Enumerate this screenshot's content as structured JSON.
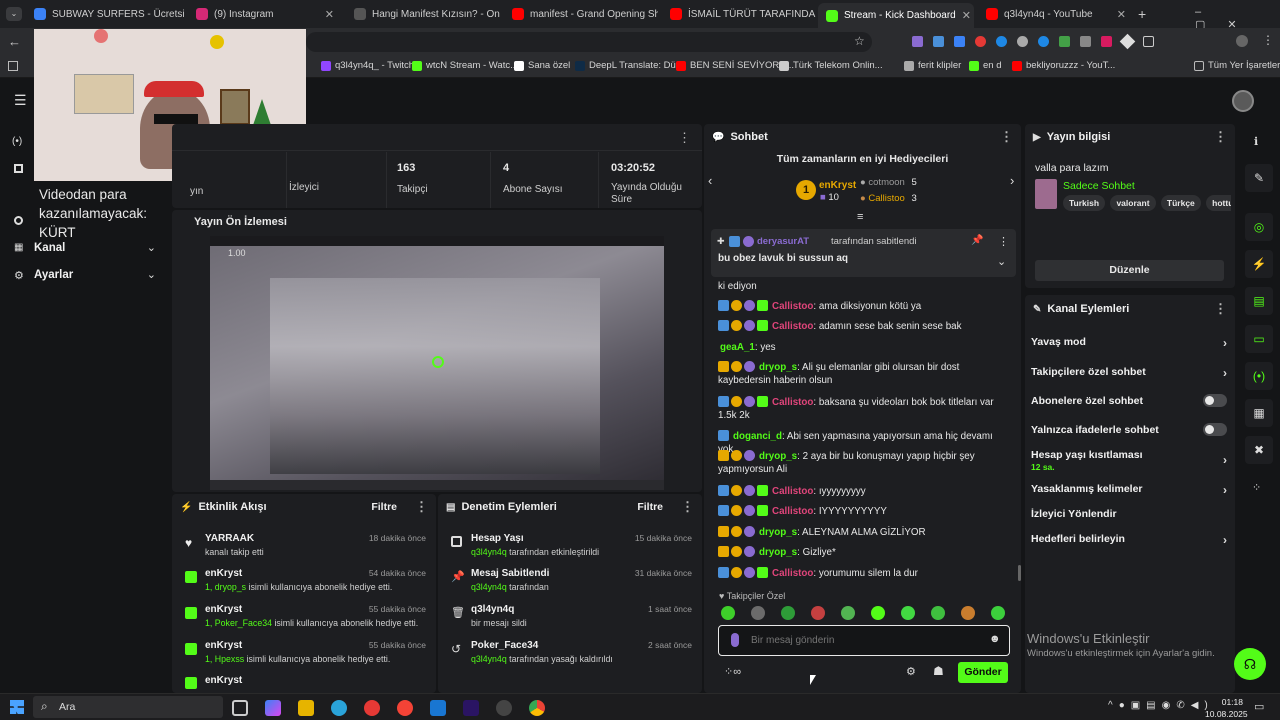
{
  "browser": {
    "tabs": [
      {
        "title": "SUBWAY SURFERS - Ücretsiz Ç",
        "color": "#3b82f6"
      },
      {
        "title": "(9) Instagram",
        "color": "#d62976"
      },
      {
        "title": "Hangi Manifest Kızısın? - Oned",
        "color": "#555555"
      },
      {
        "title": "manifest - Grand Opening Sho",
        "color": "#ff0000"
      },
      {
        "title": "İSMAİL TÜRÜT TARAFINDAN SI",
        "color": "#ff0000"
      },
      {
        "title": "Stream - Kick Dashboard",
        "color": "#53fc18"
      },
      {
        "title": "q3l4yn4q - YouTube",
        "color": "#ff0000"
      }
    ],
    "new_tab": "+",
    "bookmarks": [
      {
        "label": "q3l4yn4q_ - Twitch",
        "color": "#9146ff"
      },
      {
        "label": "wtcN Stream - Watc...",
        "color": "#53fc18"
      },
      {
        "label": "Sana özel",
        "color": "#ffffff"
      },
      {
        "label": "DeepL Translate: Dü...",
        "color": "#0f2b46"
      },
      {
        "label": "BEN SENİ SEVİYORU...",
        "color": "#ff0000"
      },
      {
        "label": "Türk Telekom Onlin...",
        "color": "#cccccc"
      },
      {
        "label": "ferit klipler",
        "color": "#aaaaaa"
      },
      {
        "label": "en d",
        "color": "#53fc18"
      },
      {
        "label": "bekliyoruzzz - YouT...",
        "color": "#ff0000"
      }
    ],
    "all_bookmarks": "Tüm Yer İşaretleri"
  },
  "sidebar": {
    "overlay_caption": "Videodan para kazanılamayacak: KÜRT",
    "items": [
      {
        "label": "Kanal"
      },
      {
        "label": "Ayarlar"
      }
    ]
  },
  "stats": {
    "first_label": "yın",
    "items": [
      {
        "value": "",
        "label": "İzleyici"
      },
      {
        "value": "163",
        "label": "Takipçi"
      },
      {
        "value": "4",
        "label": "Abone Sayısı"
      },
      {
        "value": "03:20:52",
        "label": "Yayında Olduğu Süre"
      }
    ]
  },
  "preview": {
    "title": "Yayın Ön İzlemesi",
    "zoom": "1.00"
  },
  "activity": {
    "title": "Etkinlik Akışı",
    "filter": "Filtre",
    "items": [
      {
        "name": "YARRAAK",
        "desc": "kanalı takip etti",
        "time": "18 dakika önce",
        "icon": "heart-icon"
      },
      {
        "name": "enKryst",
        "highlight": "1, dryop_s",
        "desc": " isimli kullanıcıya abonelik hediye etti.",
        "time": "54 dakika önce",
        "icon": "gift-icon"
      },
      {
        "name": "enKryst",
        "highlight": "1, Poker_Face34",
        "desc": " isimli kullanıcıya abonelik hediye etti.",
        "time": "55 dakika önce",
        "icon": "gift-icon"
      },
      {
        "name": "enKryst",
        "highlight": "1, Hpexss",
        "desc": " isimli kullanıcıya abonelik hediye etti.",
        "time": "55 dakika önce",
        "icon": "gift-icon"
      },
      {
        "name": "enKryst",
        "highlight": "",
        "desc": "",
        "time": "",
        "icon": "gift-icon"
      }
    ]
  },
  "moderation": {
    "title": "Denetim Eylemleri",
    "filter": "Filtre",
    "items": [
      {
        "name": "Hesap Yaşı",
        "user": "q3l4yn4q",
        "desc": " tarafından etkinleştirildi",
        "time": "15 dakika önce",
        "icon": "calendar-icon"
      },
      {
        "name": "Mesaj Sabitlendi",
        "user": "q3l4yn4q",
        "desc": " tarafından",
        "time": "31 dakika önce",
        "icon": "pin-icon"
      },
      {
        "name": "q3l4yn4q",
        "user": "",
        "desc": "bir mesajı sildi",
        "time": "1 saat önce",
        "icon": "trash-icon"
      },
      {
        "name": "Poker_Face34",
        "user": "q3l4yn4q",
        "desc": " tarafından yasağı kaldırıldı",
        "time": "2 saat önce",
        "icon": "undo-icon"
      }
    ]
  },
  "chat": {
    "title": "Sohbet",
    "gifters_title": "Tüm zamanların en iyi Hediyecileri",
    "top_gifter": {
      "name": "enKryst",
      "count": "10",
      "rank": "1"
    },
    "gifters": [
      {
        "name": "cotmoon",
        "count": "5"
      },
      {
        "name": "Callistoo",
        "count": "3"
      }
    ],
    "pinned": {
      "user": "deryasurAT",
      "by": "tarafından sabitlendi",
      "text": "bu obez lavuk bi sussun aq"
    },
    "messages": [
      {
        "user": "",
        "color": "",
        "text": "ki ediyon",
        "badges": ""
      },
      {
        "user": "Callistoo",
        "color": "pink",
        "text": "ama diksiyonun kötü ya",
        "badges": "bgpG"
      },
      {
        "user": "Callistoo",
        "color": "pink",
        "text": "adamın sese bak senin sese bak",
        "badges": "bgpG"
      },
      {
        "user": "geaA_1",
        "color": "green",
        "text": "yes",
        "badges": ""
      },
      {
        "user": "dryop_s",
        "color": "green",
        "text": "Ali şu elemanlar gibi olursan bir dost kaybedersin haberin olsun",
        "badges": "cgp"
      },
      {
        "user": "Callistoo",
        "color": "pink",
        "text": "baksana şu videoları bok bok titleları var 1.5k 2k",
        "badges": "bgpG"
      },
      {
        "user": "doganci_d",
        "color": "green",
        "text": "Abi sen yapmasına yapıyorsun ama hiç devamı yok",
        "badges": "b"
      },
      {
        "user": "dryop_s",
        "color": "green",
        "text": "2 aya bir bu konuşmayı yapıp hiçbir şey yapmıyorsun Ali",
        "badges": "cgp"
      },
      {
        "user": "Callistoo",
        "color": "pink",
        "text": "ıyyyyyyyyy",
        "badges": "bgpG"
      },
      {
        "user": "Callistoo",
        "color": "pink",
        "text": "IYYYYYYYYYY",
        "badges": "bgpG"
      },
      {
        "user": "dryop_s",
        "color": "green",
        "text": "ALEYNAM ALMA GİZLİYOR",
        "badges": "cgp"
      },
      {
        "user": "dryop_s",
        "color": "green",
        "text": "Gizliye*",
        "badges": "cgp"
      },
      {
        "user": "Callistoo",
        "color": "pink",
        "text": "yorumumu silem la dur",
        "badges": "bgpG"
      }
    ],
    "followers_only": "Takipçiler Özel",
    "input_placeholder": "Bir mesaj gönderin",
    "send": "Gönder"
  },
  "stream_info": {
    "title": "Yayın bilgisi",
    "stream_title": "valla para lazım",
    "category": "Sadece Sohbet",
    "tags": [
      "Turkish",
      "valorant",
      "Türkçe",
      "hottul"
    ],
    "edit": "Düzenle"
  },
  "channel_actions": {
    "title": "Kanal Eylemleri",
    "items": [
      {
        "label": "Yavaş mod",
        "control": "chevron"
      },
      {
        "label": "Takipçilere özel sohbet",
        "control": "chevron"
      },
      {
        "label": "Abonelere özel sohbet",
        "control": "toggle"
      },
      {
        "label": "Yalnızca ifadelerle sohbet",
        "control": "toggle"
      },
      {
        "label": "Hesap yaşı kısıtlaması",
        "sub": "12 sa.",
        "control": "chevron"
      },
      {
        "label": "Yasaklanmış kelimeler",
        "control": "chevron"
      },
      {
        "label": "İzleyici Yönlendir",
        "control": ""
      },
      {
        "label": "Hedefleri belirleyin",
        "control": "chevron"
      }
    ]
  },
  "windows": {
    "activate_title": "Windows'u Etkinleştir",
    "activate_sub": "Windows'u etkinleştirmek için Ayarlar'a gidin.",
    "search": "Ara",
    "time": "01:18",
    "date": "10.08.2025"
  }
}
